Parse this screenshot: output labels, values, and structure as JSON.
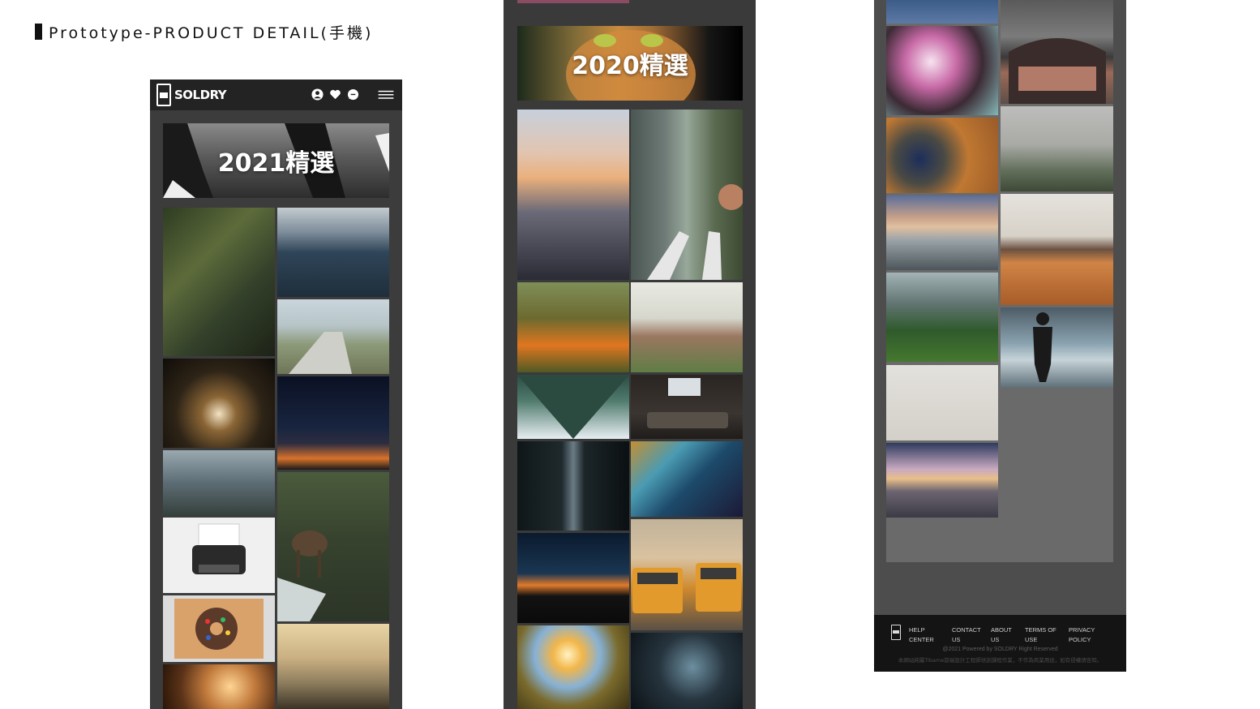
{
  "page": {
    "title": "Prototype-PRODUCT DETAIL(手機)"
  },
  "screen1": {
    "brand": "SOLDRY",
    "icons": [
      "user-icon",
      "heart-icon",
      "chat-icon",
      "menu-icon"
    ],
    "banner": "2021精選"
  },
  "screen2": {
    "banner": "2020精選"
  },
  "screen3": {
    "footer": {
      "links": [
        "HELP\nCENTER",
        "CONTACT\nUS",
        "ABOUT\nUS",
        "TERMS OF\nUSE",
        "PRIVACY\nPOLICY"
      ],
      "copyright": "@2021 Powered by SOLDRY Right Reserved",
      "note": "本網站純屬Tibame前端設計工程師培訓課程作業，不作為商業用途，如有侵權請告知。"
    }
  },
  "colors": {
    "accent": "#f0a020",
    "header": "#232323",
    "footer": "#141414"
  }
}
